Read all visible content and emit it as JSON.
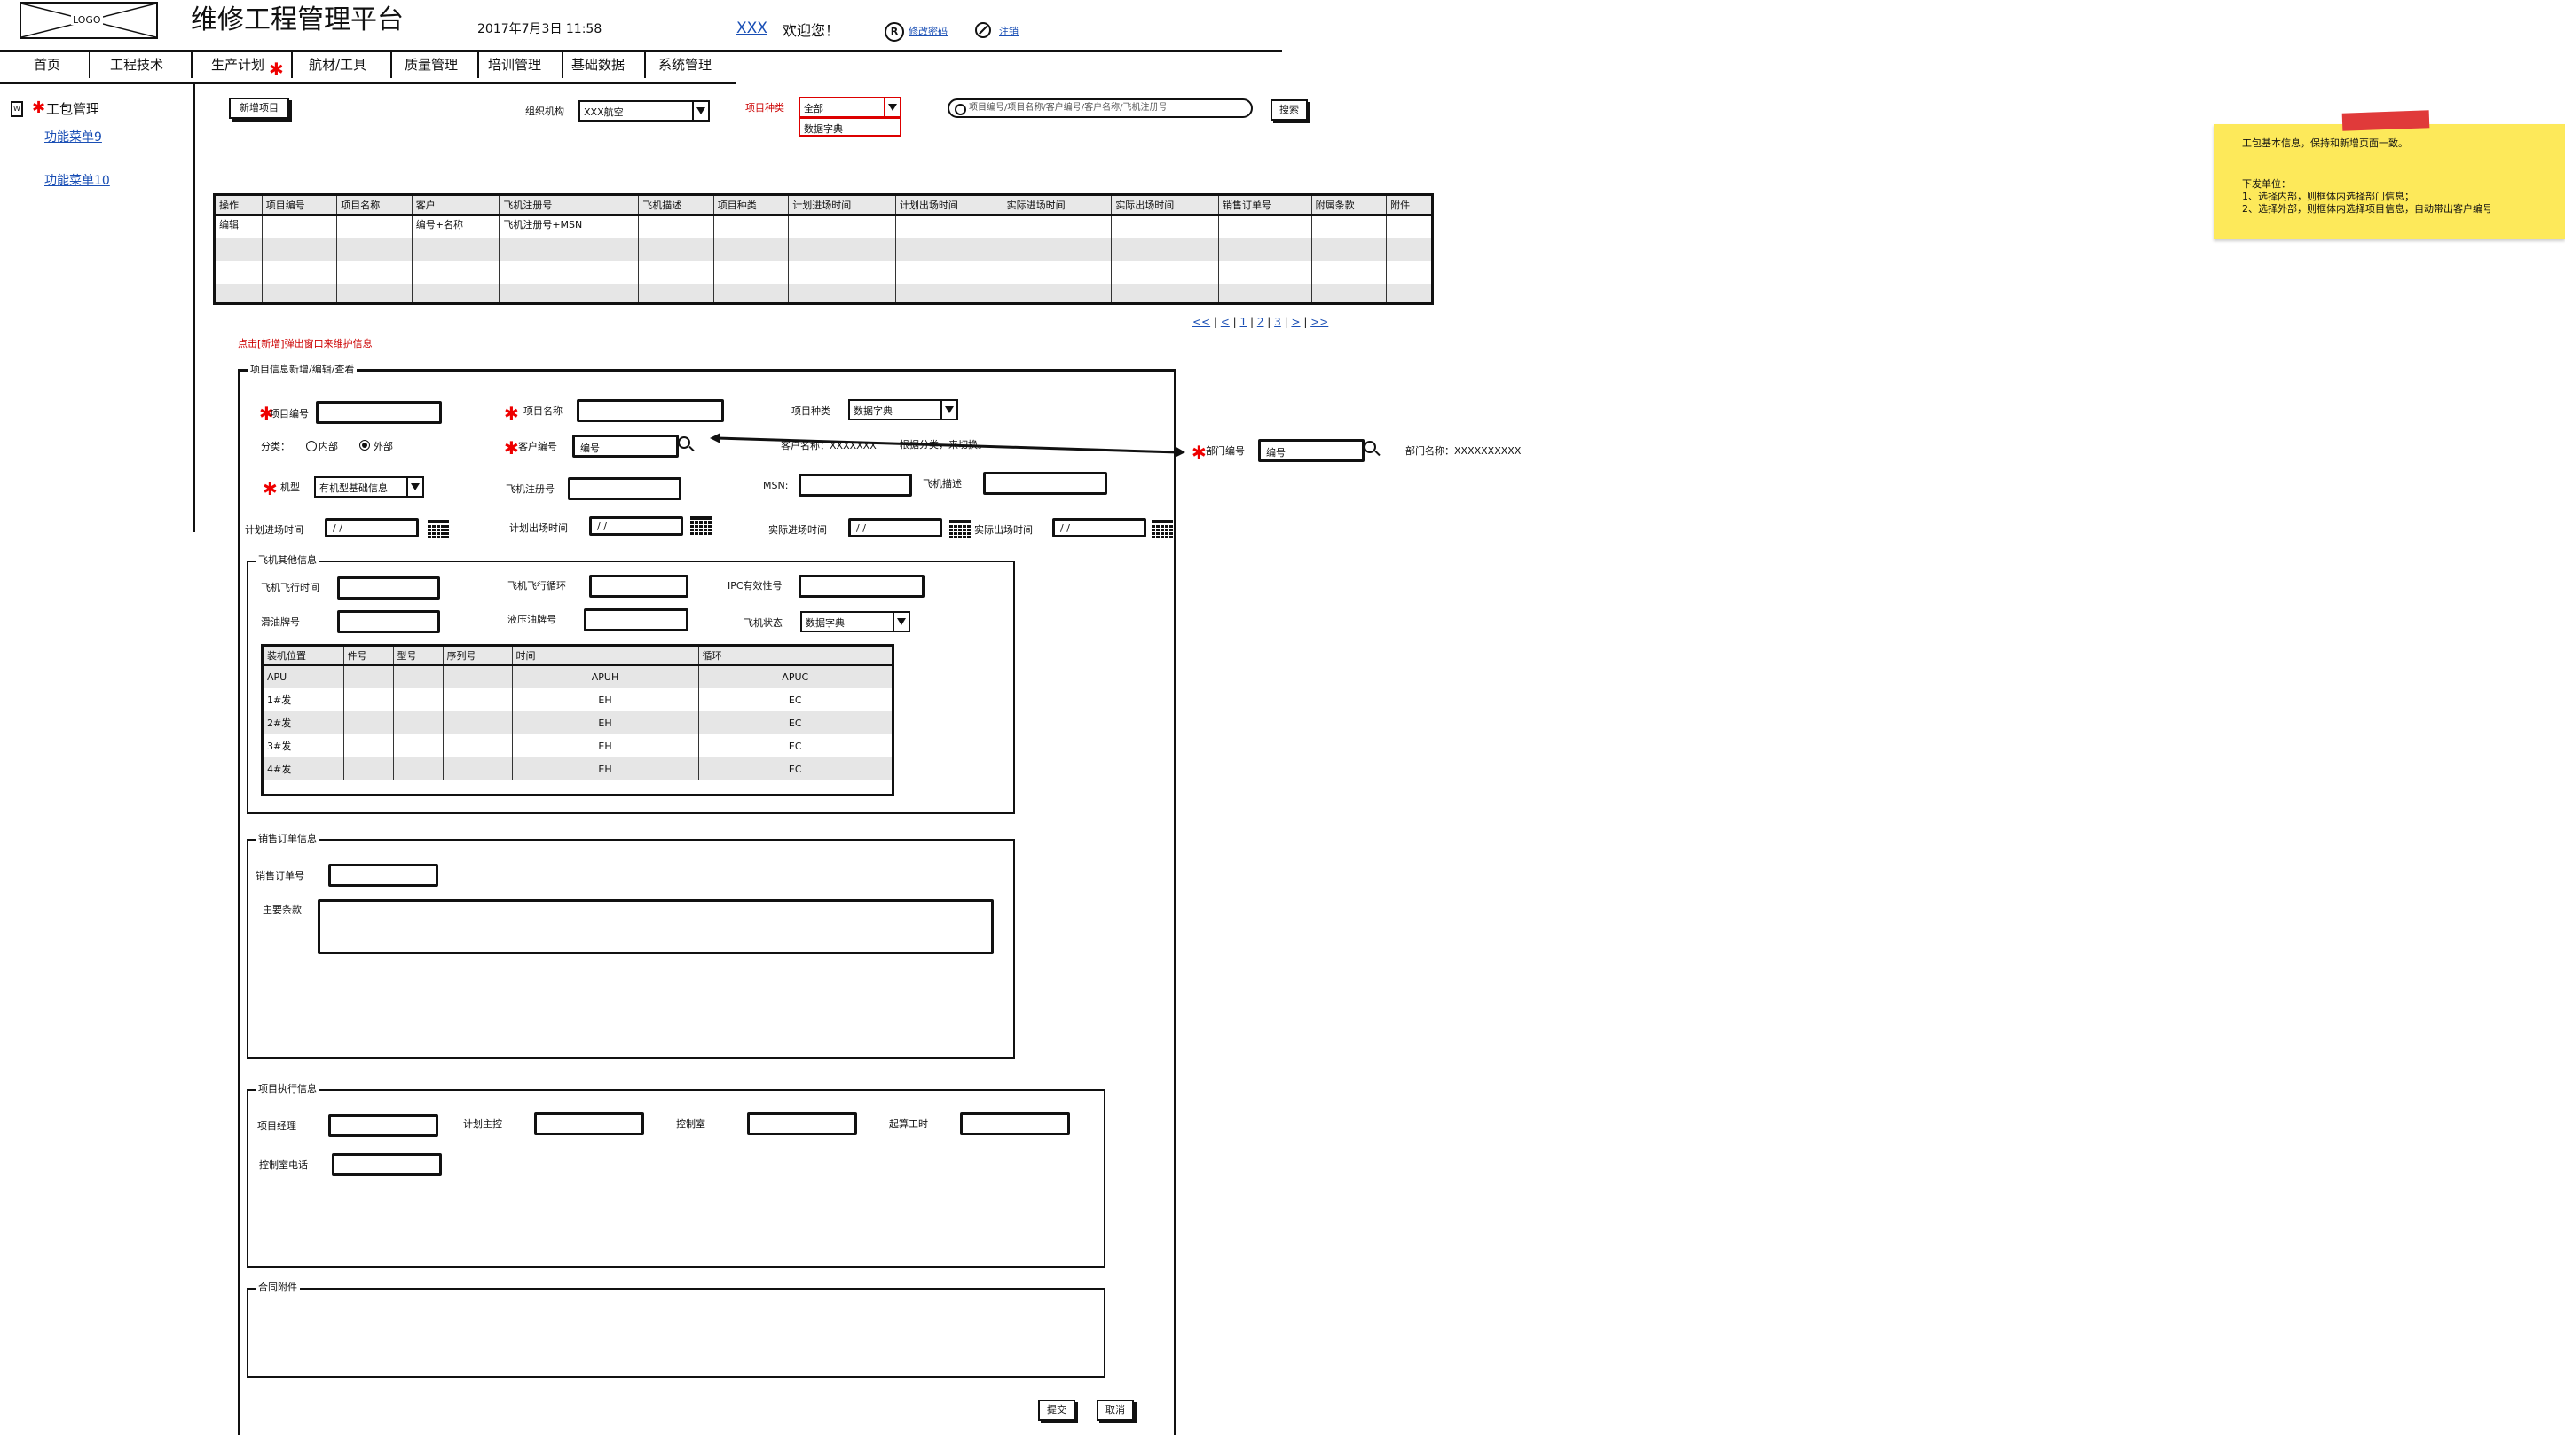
{
  "header": {
    "logo": "LOGO",
    "app_title": "维修工程管理平台",
    "datetime": "2017年7月3日  11:58",
    "user": "XXX",
    "welcome": "欢迎您！",
    "change_password": "修改密码",
    "logout": "注销"
  },
  "nav": [
    "首页",
    "工程技术",
    "生产计划",
    "航材/工具",
    "质量管理",
    "培训管理",
    "基础数据",
    "系统管理"
  ],
  "sidebar": {
    "section": "工包管理",
    "items": [
      "功能菜单9",
      "功能菜单10"
    ]
  },
  "toolbar": {
    "new_button": "新增项目",
    "org_label": "组织机构",
    "org_value": "XXX航空",
    "type_label": "项目种类",
    "type_value": "全部",
    "type_option": "数据字典",
    "search_placeholder": "项目编号/项目名称/客户编号/客户名称/飞机注册号",
    "search_button": "搜索"
  },
  "table": {
    "headers": [
      "操作",
      "项目编号",
      "项目名称",
      "客户",
      "飞机注册号",
      "飞机描述",
      "项目种类",
      "计划进场时间",
      "计划出场时间",
      "实际进场时间",
      "实际出场时间",
      "销售订单号",
      "附属条款",
      "附件"
    ],
    "row": [
      "编辑",
      "",
      "",
      "编号+名称",
      "飞机注册号+MSN",
      "",
      "",
      "",
      "",
      "",
      "",
      "",
      "",
      ""
    ]
  },
  "pagination": [
    "<<",
    "<",
    "1",
    "2",
    "3",
    ">",
    ">>"
  ],
  "popup_note": "点击[新增]弹出窗口来维护信息",
  "form": {
    "title": "项目信息新增/编辑/查看",
    "project_no": "项目编号",
    "project_name": "项目名称",
    "project_type": "项目种类",
    "project_type_value": "数据字典",
    "category": "分类：",
    "internal": "内部",
    "external": "外部",
    "customer_no": "客户编号",
    "customer_no_value": "编号",
    "customer_name": "客户名称：XXXXXXX",
    "annotation": "根据分类，来切换。",
    "dept_no": "部门编号",
    "dept_no_value": "编号",
    "dept_name": "部门名称：XXXXXXXXXX",
    "model": "机型",
    "model_value": "有机型基础信息",
    "registration": "飞机注册号",
    "msn": "MSN:",
    "aircraft_desc": "飞机描述",
    "plan_in": "计划进场时间",
    "plan_out": "计划出场时间",
    "actual_in": "实际进场时间",
    "actual_out": "实际出场时间",
    "date_placeholder": "/  /"
  },
  "aircraft": {
    "title": "飞机其他信息",
    "flight_hours": "飞机飞行时间",
    "flight_cycles": "飞机飞行循环",
    "ipc": "IPC有效性号",
    "oil": "滑油牌号",
    "hydraulic": "液压油牌号",
    "status": "飞机状态",
    "status_value": "数据字典",
    "headers": [
      "装机位置",
      "件号",
      "型号",
      "序列号",
      "时间",
      "循环"
    ],
    "rows": [
      [
        "APU",
        "",
        "",
        "",
        "APUH",
        "APUC"
      ],
      [
        "1#发",
        "",
        "",
        "",
        "EH",
        "EC"
      ],
      [
        "2#发",
        "",
        "",
        "",
        "EH",
        "EC"
      ],
      [
        "3#发",
        "",
        "",
        "",
        "EH",
        "EC"
      ],
      [
        "4#发",
        "",
        "",
        "",
        "EH",
        "EC"
      ]
    ]
  },
  "sales": {
    "title": "销售订单信息",
    "order_no": "销售订单号",
    "terms": "主要条款"
  },
  "exec": {
    "title": "项目执行信息",
    "manager": "项目经理",
    "planner": "计划主控",
    "control": "控制室",
    "hours": "起算工时",
    "control_phone": "控制室电话"
  },
  "contract": {
    "title": "合同附件"
  },
  "buttons": {
    "submit": "提交",
    "cancel": "取消"
  },
  "sticky": {
    "line1": "工包基本信息，保持和新增页面一致。",
    "line2": "下发单位：",
    "line3": "1、选择内部，则框体内选择部门信息；",
    "line4": "2、选择外部，则框体内选择项目信息，自动带出客户编号"
  }
}
